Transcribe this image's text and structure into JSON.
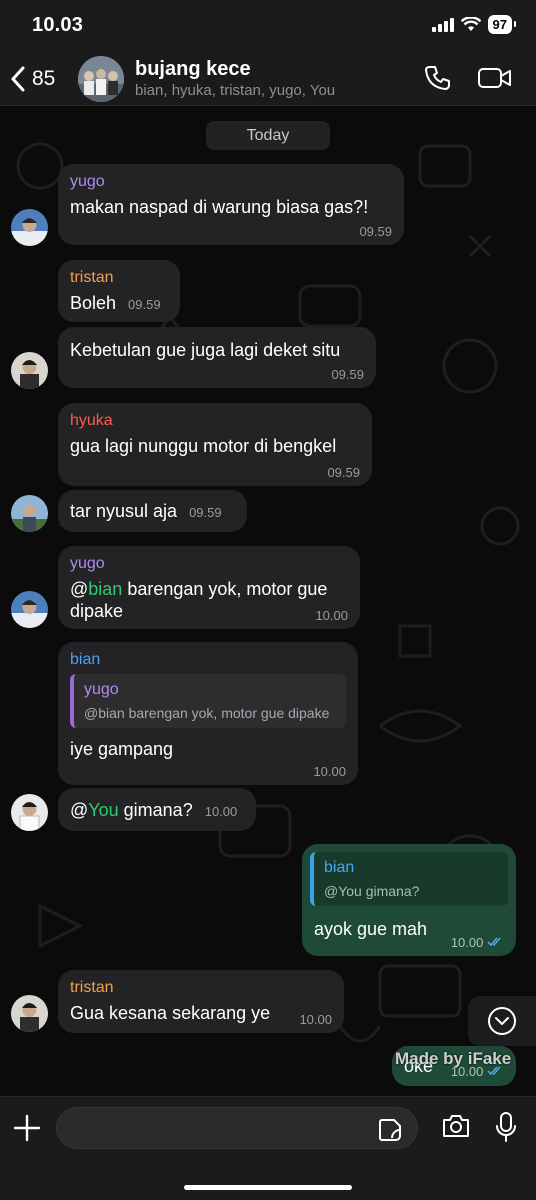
{
  "status_bar": {
    "time": "10.03",
    "battery": "97"
  },
  "header": {
    "back_count": "85",
    "group_name": "bujang kece",
    "members": "bian, hyuka, tristan, yugo, You"
  },
  "date_chip": "Today",
  "colors": {
    "yugo": "#b18cf0",
    "tristan": "#f0a04b",
    "hyuka": "#ff5a4e",
    "bian": "#4aa3f0",
    "mention": "#2ecc71",
    "outgoing_bubble": "#1f4a37",
    "incoming_bubble": "#232325"
  },
  "messages": [
    {
      "sender": "yugo",
      "text": "makan naspad di warung biasa gas?!",
      "time": "09.59"
    },
    {
      "sender": "tristan",
      "text": "Boleh",
      "time": "09.59"
    },
    {
      "text": "Kebetulan gue juga lagi deket situ",
      "time": "09.59"
    },
    {
      "sender": "hyuka",
      "text": "gua lagi nunggu motor di bengkel",
      "time": "09.59"
    },
    {
      "text": "tar nyusul aja",
      "time": "09.59"
    },
    {
      "sender": "yugo",
      "mention_prefix": "@",
      "mention": "bian",
      "text_after": " barengan yok, motor gue",
      "text_line2": "dipake",
      "time": "10.00"
    },
    {
      "sender": "bian",
      "quote_name": "yugo",
      "quote_text": "@bian barengan yok, motor gue dipake",
      "text": "iye gampang",
      "time": "10.00"
    },
    {
      "mention_prefix": "@",
      "mention": "You",
      "text_after": " gimana?",
      "time": "10.00"
    },
    {
      "quote_name": "bian",
      "quote_text": "@You gimana?",
      "text": "ayok gue mah",
      "time": "10.00",
      "status": "read"
    },
    {
      "sender": "tristan",
      "text": "Gua kesana sekarang ye",
      "time": "10.00"
    },
    {
      "text": "oke",
      "time": "10.00",
      "status": "read"
    }
  ],
  "watermark": "Made by iFake",
  "icons": {
    "back": "chevron-left-icon",
    "call": "phone-icon",
    "video": "video-camera-icon",
    "scroll": "chevron-down-circle-icon",
    "attach": "plus-icon",
    "sticker": "sticker-icon",
    "camera": "camera-icon",
    "mic": "microphone-icon"
  }
}
